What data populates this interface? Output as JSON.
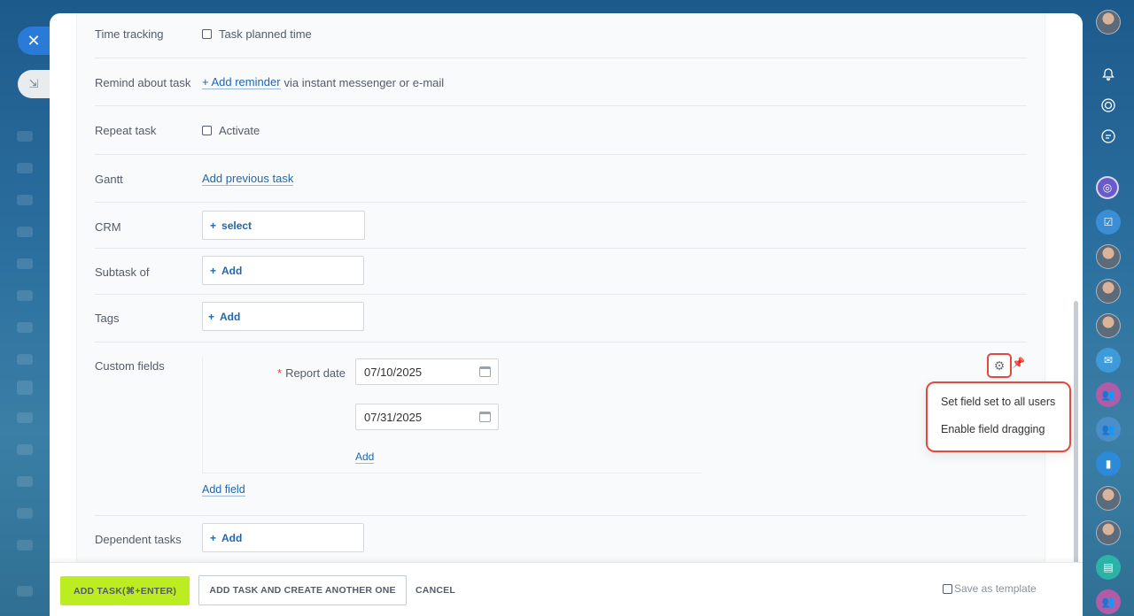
{
  "form": {
    "time_tracking": {
      "label": "Time tracking",
      "option": "Task planned time"
    },
    "remind": {
      "label": "Remind about task",
      "link": "+ Add reminder",
      "suffix": "via instant messenger or e-mail"
    },
    "repeat": {
      "label": "Repeat task",
      "option": "Activate"
    },
    "gantt": {
      "label": "Gantt",
      "link": "Add previous task"
    },
    "crm": {
      "label": "CRM",
      "button": "select"
    },
    "subtask": {
      "label": "Subtask of",
      "button": "Add"
    },
    "tags": {
      "label": "Tags",
      "button": "Add"
    },
    "custom_fields": {
      "label": "Custom fields",
      "report_date_label": "Report date",
      "date1": "07/10/2025",
      "date2": "07/31/2025",
      "add_link": "Add",
      "add_field_link": "Add field"
    },
    "dependent": {
      "label": "Dependent tasks",
      "button": "Add"
    }
  },
  "settings_menu": {
    "items": [
      "Set field set to all users",
      "Enable field dragging"
    ]
  },
  "footer": {
    "add_task": "ADD TASK(⌘+ENTER)",
    "add_and_create": "ADD TASK AND CREATE ANOTHER ONE",
    "cancel": "CANCEL",
    "save_template": "Save as template"
  },
  "icons": {
    "close": "close-icon",
    "collapse": "collapse-icon",
    "gear": "gear-icon",
    "pin": "pin-icon",
    "calendar": "calendar-icon"
  },
  "colors": {
    "primary_button": "#bbed21",
    "link": "#2067b0",
    "highlight": "#e5483e",
    "close_button": "#2a7bd8"
  }
}
